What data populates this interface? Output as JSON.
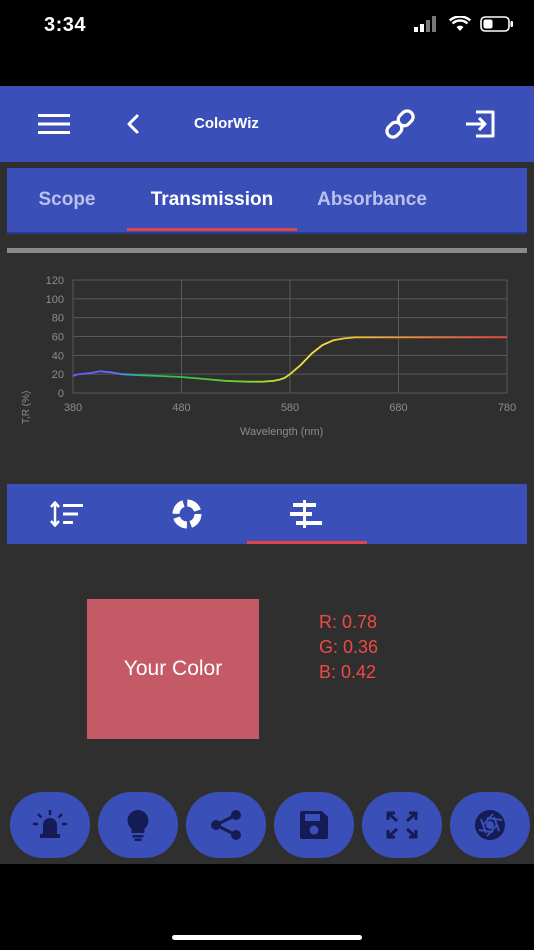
{
  "status_bar": {
    "time": "3:34"
  },
  "header": {
    "title": "ColorWiz"
  },
  "tabs": [
    {
      "label": "Scope"
    },
    {
      "label": "Transmission"
    },
    {
      "label": "Absorbance"
    }
  ],
  "active_tab": "Transmission",
  "chart_data": {
    "type": "line",
    "xlabel": "Wavelength (nm)",
    "ylabel": "T,R (%)",
    "xlim": [
      380,
      780
    ],
    "ylim": [
      0,
      120
    ],
    "x_ticks": [
      "380",
      "480",
      "580",
      "680",
      "780"
    ],
    "y_ticks": [
      "0",
      "20",
      "40",
      "60",
      "80",
      "100",
      "120"
    ],
    "grid": true,
    "series": [
      {
        "x": [
          380,
          385,
          395,
          405,
          415,
          425,
          440,
          460,
          480,
          500,
          520,
          540,
          555,
          565,
          570,
          575,
          580,
          590,
          600,
          610,
          620,
          630,
          640,
          660,
          680,
          700,
          720,
          740,
          760,
          780
        ],
        "y": [
          18,
          20,
          21,
          23,
          22,
          20,
          19,
          18,
          17,
          15,
          13,
          12,
          12,
          13,
          14,
          16,
          20,
          30,
          42,
          51,
          56,
          58,
          59,
          59,
          59,
          59,
          59,
          59,
          59,
          59
        ]
      }
    ]
  },
  "sub_tabs": {
    "icons": [
      "sort-lines-icon",
      "color-wheel-icon",
      "align-bars-icon"
    ],
    "active": 2
  },
  "swatch": {
    "label": "Your Color",
    "color": "#c55a67"
  },
  "rgb": {
    "r": "R: 0.78",
    "g": "G: 0.36",
    "b": "B: 0.42"
  },
  "actions": [
    "light-icon",
    "bulb-icon",
    "share-icon",
    "save-icon",
    "expand-icon",
    "aperture-icon"
  ],
  "colors": {
    "primary": "#3b4fb8",
    "background": "#2f2f2f",
    "accent": "#e04444",
    "rgb_text": "#ee4a44"
  }
}
